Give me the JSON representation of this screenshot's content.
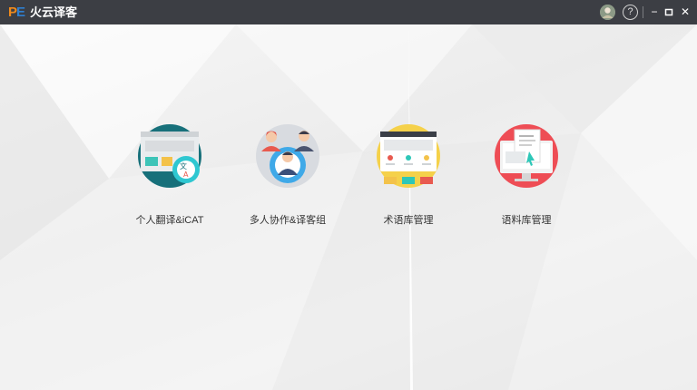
{
  "app": {
    "logo_p": "P",
    "logo_e": "E",
    "title": "火云译客"
  },
  "titlebar": {
    "help": "?",
    "minimize": "−",
    "maximize": "□",
    "close": "✕"
  },
  "modules": [
    {
      "label": "个人翻译&iCAT",
      "icon": "personal-translation-icon"
    },
    {
      "label": "多人协作&译客组",
      "icon": "team-collaboration-icon"
    },
    {
      "label": "术语库管理",
      "icon": "termbase-icon"
    },
    {
      "label": "语料库管理",
      "icon": "corpus-icon"
    }
  ],
  "colors": {
    "titlebar": "#3c3e44",
    "logo_p": "#f08a1c",
    "logo_e": "#2f7fd0"
  }
}
